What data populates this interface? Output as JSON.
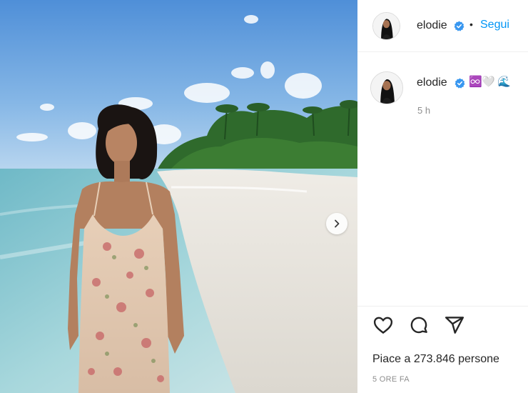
{
  "post": {
    "username": "elodie",
    "follow_label": "Segui",
    "separator": "•",
    "caption": {
      "username": "elodie",
      "emojis": [
        "♾️",
        "🤍",
        "🌊"
      ],
      "time": "5 h"
    },
    "likes_text": "Piace a 273.846 persone",
    "date_text": "5 ORE FA"
  },
  "icons": {
    "verified": "verified-badge-icon",
    "like": "heart-icon",
    "comment": "comment-icon",
    "share": "paper-plane-icon",
    "next": "chevron-right-icon"
  },
  "colors": {
    "accent": "#0095f6",
    "text": "#262626",
    "muted": "#8e8e8e"
  }
}
